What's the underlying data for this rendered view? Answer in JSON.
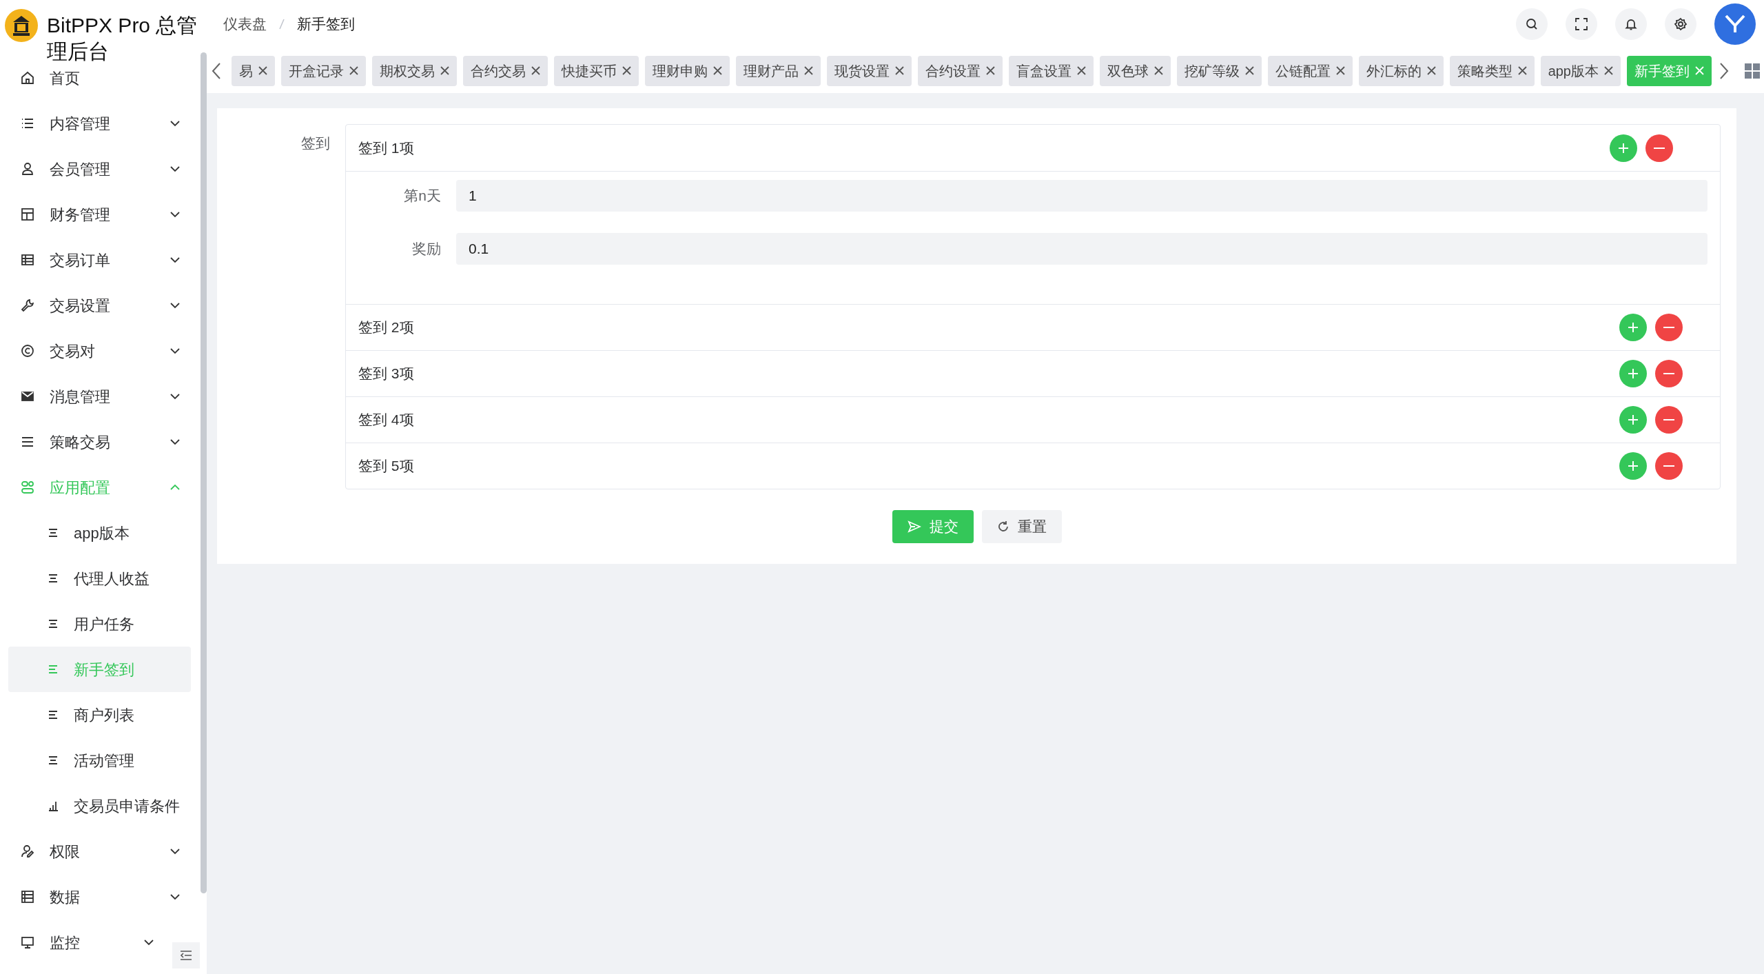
{
  "header": {
    "title": "BitPPX Pro 总管理后台",
    "breadcrumb": [
      {
        "label": "仪表盘",
        "selected": false
      },
      {
        "label": "新手签到",
        "selected": true
      }
    ]
  },
  "sidebar": {
    "items": [
      {
        "label": "首页",
        "kind": "link",
        "selected": false
      },
      {
        "label": "内容管理",
        "kind": "group",
        "expanded": false
      },
      {
        "label": "会员管理",
        "kind": "group",
        "expanded": false
      },
      {
        "label": "财务管理",
        "kind": "group",
        "expanded": false
      },
      {
        "label": "交易订单",
        "kind": "group",
        "expanded": false
      },
      {
        "label": "交易设置",
        "kind": "group",
        "expanded": false
      },
      {
        "label": "交易对",
        "kind": "group",
        "expanded": false
      },
      {
        "label": "消息管理",
        "kind": "group",
        "expanded": false
      },
      {
        "label": "策略交易",
        "kind": "group",
        "expanded": false
      },
      {
        "label": "应用配置",
        "kind": "group",
        "expanded": true,
        "children": [
          {
            "label": "app版本",
            "selected": false
          },
          {
            "label": "代理人收益",
            "selected": false
          },
          {
            "label": "用户任务",
            "selected": false
          },
          {
            "label": "新手签到",
            "selected": true
          },
          {
            "label": "商户列表",
            "selected": false
          },
          {
            "label": "活动管理",
            "selected": false
          },
          {
            "label": "交易员申请条件",
            "selected": false
          }
        ]
      },
      {
        "label": "权限",
        "kind": "group",
        "expanded": false
      },
      {
        "label": "数据",
        "kind": "group",
        "expanded": false
      },
      {
        "label": "监控",
        "kind": "group",
        "expanded": false
      }
    ]
  },
  "tabs": [
    {
      "label": "易",
      "selected": false
    },
    {
      "label": "开盒记录",
      "selected": false
    },
    {
      "label": "期权交易",
      "selected": false
    },
    {
      "label": "合约交易",
      "selected": false
    },
    {
      "label": "快捷买币",
      "selected": false
    },
    {
      "label": "理财申购",
      "selected": false
    },
    {
      "label": "理财产品",
      "selected": false
    },
    {
      "label": "现货设置",
      "selected": false
    },
    {
      "label": "合约设置",
      "selected": false
    },
    {
      "label": "盲盒设置",
      "selected": false
    },
    {
      "label": "双色球",
      "selected": false
    },
    {
      "label": "挖矿等级",
      "selected": false
    },
    {
      "label": "公链配置",
      "selected": false
    },
    {
      "label": "外汇标的",
      "selected": false
    },
    {
      "label": "策略类型",
      "selected": false
    },
    {
      "label": "app版本",
      "selected": false
    },
    {
      "label": "新手签到",
      "selected": true
    }
  ],
  "form": {
    "label": "签到",
    "items": [
      {
        "title": "签到 1项",
        "expanded": true,
        "fields": [
          {
            "label": "第n天",
            "value": "1"
          },
          {
            "label": "奖励",
            "value": "0.1"
          }
        ]
      },
      {
        "title": "签到 2项",
        "expanded": false
      },
      {
        "title": "签到 3项",
        "expanded": false
      },
      {
        "title": "签到 4项",
        "expanded": false
      },
      {
        "title": "签到 5项",
        "expanded": false
      }
    ],
    "buttons": [
      {
        "label": "提交",
        "kind": "primary"
      },
      {
        "label": "重置",
        "kind": "default"
      }
    ]
  }
}
